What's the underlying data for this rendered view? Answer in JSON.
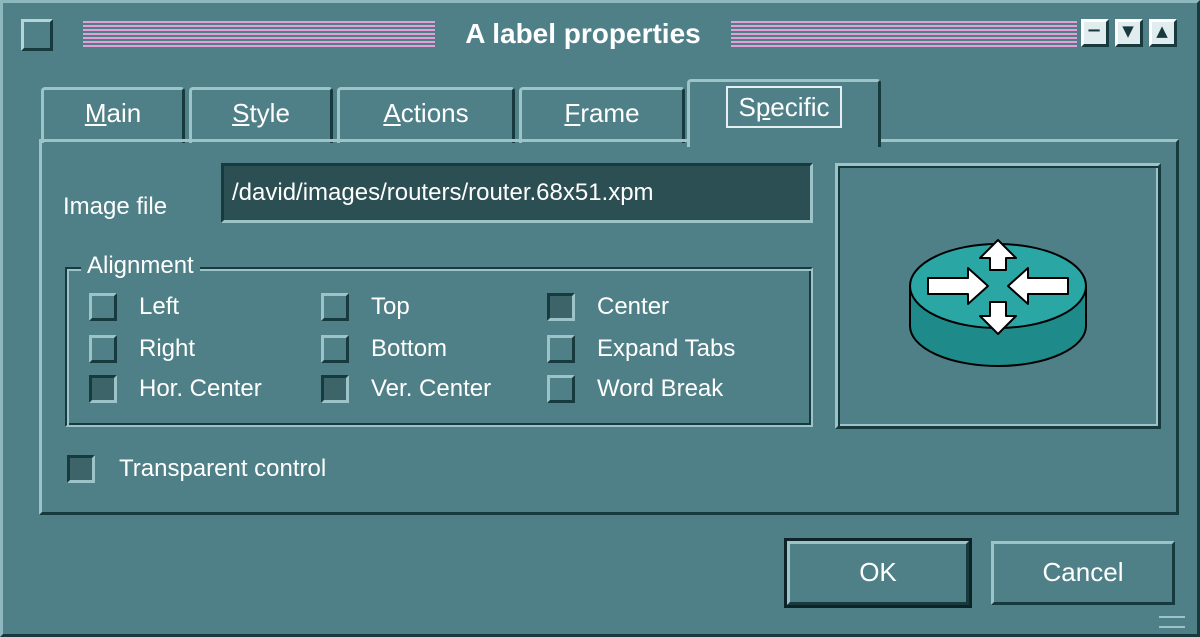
{
  "window": {
    "title": "A label properties"
  },
  "titlebar_buttons": [
    "minimize-icon",
    "maximize-icon",
    "close-icon"
  ],
  "tabs": [
    {
      "label_prefix": "",
      "mnemonic": "M",
      "label_rest": "ain",
      "active": false
    },
    {
      "label_prefix": "",
      "mnemonic": "S",
      "label_rest": "tyle",
      "active": false
    },
    {
      "label_prefix": "",
      "mnemonic": "A",
      "label_rest": "ctions",
      "active": false
    },
    {
      "label_prefix": "",
      "mnemonic": "F",
      "label_rest": "rame",
      "active": false
    },
    {
      "label_prefix": "S",
      "mnemonic": "p",
      "label_rest": "ecific",
      "active": true
    }
  ],
  "image_file": {
    "label": "Image file",
    "value": "/david/images/routers/router.68x51.xpm"
  },
  "alignment": {
    "legend": "Alignment",
    "options": [
      {
        "label": "Left",
        "checked": false
      },
      {
        "label": "Top",
        "checked": false
      },
      {
        "label": "Center",
        "checked": true
      },
      {
        "label": "Right",
        "checked": false
      },
      {
        "label": "Bottom",
        "checked": false
      },
      {
        "label": "Expand Tabs",
        "checked": false
      },
      {
        "label": "Hor. Center",
        "checked": true
      },
      {
        "label": "Ver. Center",
        "checked": true
      },
      {
        "label": "Word Break",
        "checked": false
      }
    ]
  },
  "transparent": {
    "label": "Transparent control",
    "checked": true
  },
  "buttons": {
    "ok": "OK",
    "cancel": "Cancel"
  },
  "colors": {
    "background": "#4f8088",
    "title_stripes": "#e69ed8",
    "field_background": "#2c4f53",
    "text": "#ffffff"
  }
}
